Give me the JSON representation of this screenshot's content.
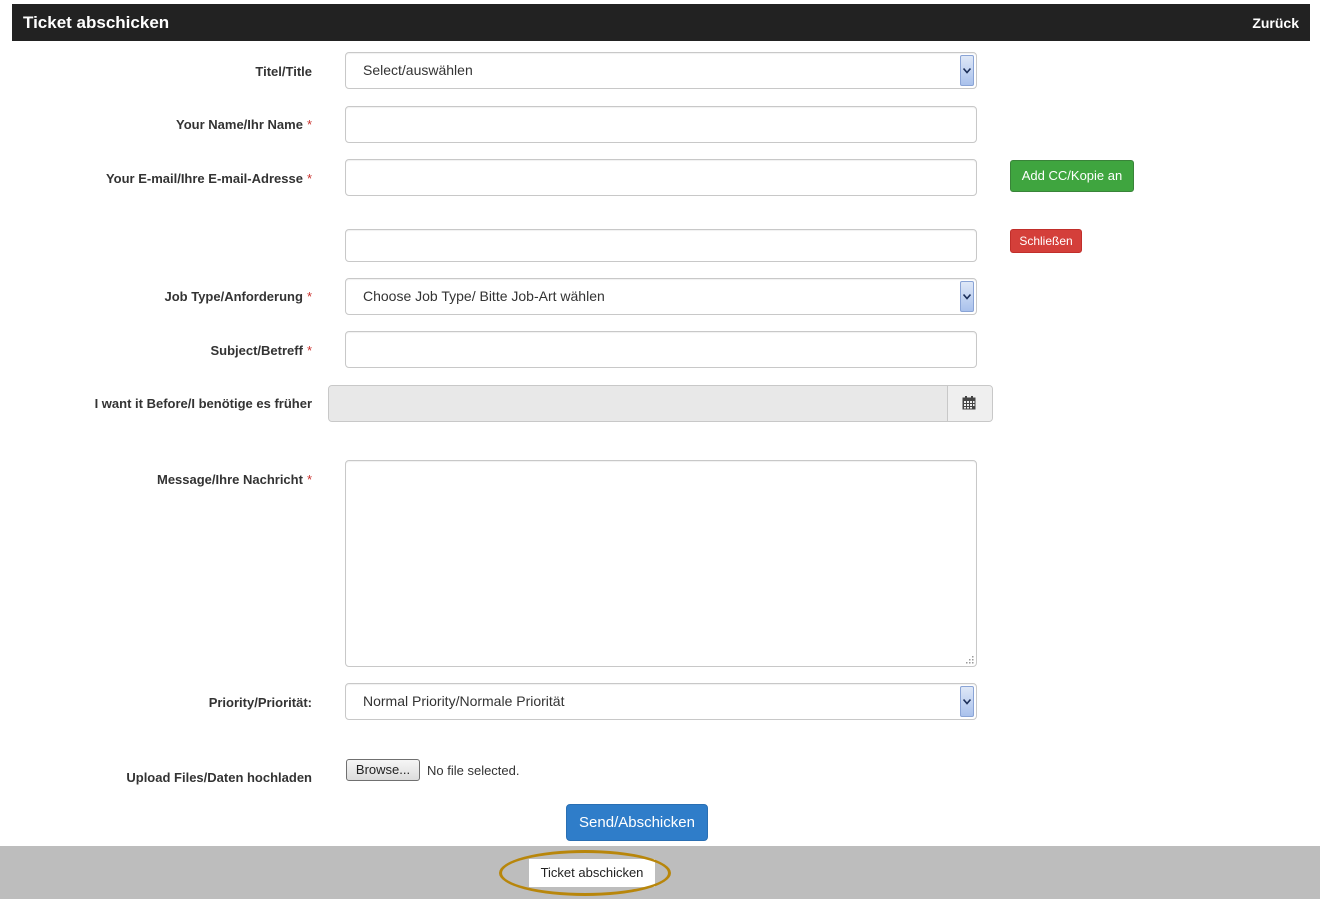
{
  "header": {
    "title": "Ticket abschicken",
    "back_label": "Zurück"
  },
  "form": {
    "title_field": {
      "label": "Titel/Title",
      "selected": "Select/auswählen"
    },
    "name_field": {
      "label": "Your Name/Ihr Name",
      "required_mark": "*",
      "value": ""
    },
    "email_field": {
      "label": "Your E-mail/Ihre E-mail-Adresse",
      "required_mark": "*",
      "value": ""
    },
    "add_cc_label": "Add CC/Kopie an",
    "cc_field": {
      "value": ""
    },
    "close_label": "Schließen",
    "job_type_field": {
      "label": "Job Type/Anforderung",
      "required_mark": "*",
      "selected": "Choose Job Type/ Bitte Job-Art wählen"
    },
    "subject_field": {
      "label": "Subject/Betreff",
      "required_mark": "*",
      "value": ""
    },
    "date_field": {
      "label": "I want it Before/I benötige es früher",
      "value": "",
      "icon": "calendar-icon"
    },
    "message_field": {
      "label": "Message/Ihre Nachricht",
      "required_mark": "*",
      "value": ""
    },
    "priority_field": {
      "label": "Priority/Priorität:",
      "selected": "Normal Priority/Normale Priorität"
    },
    "upload_field": {
      "label": "Upload Files/Daten hochladen",
      "browse_label": "Browse...",
      "status": "No file selected."
    },
    "submit_label": "Send/Abschicken"
  },
  "footer": {
    "button_label": "Ticket abschicken",
    "highlight_color": "#b8860b"
  },
  "colors": {
    "header_bg": "#222222",
    "success": "#3fa53f",
    "danger": "#d43f3a",
    "primary": "#2f7dc9",
    "required": "#c9302c"
  }
}
